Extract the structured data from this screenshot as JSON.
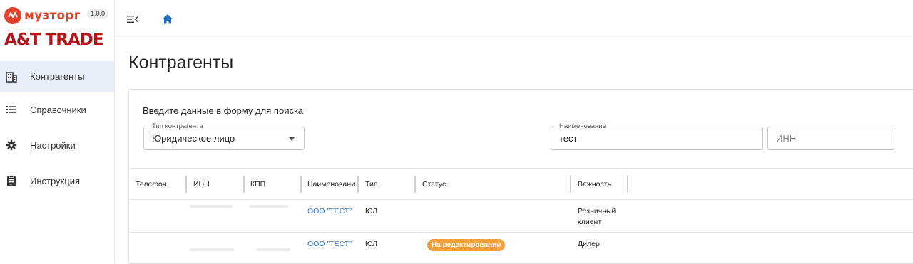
{
  "app": {
    "brand_name": "музторг",
    "brand_sub": "A&T TRADE",
    "version": "1.0.0"
  },
  "sidebar": {
    "items": [
      {
        "label": "Контрагенты",
        "icon": "building-icon",
        "active": true
      },
      {
        "label": "Справочники",
        "icon": "list-icon",
        "active": false
      },
      {
        "label": "Настройки",
        "icon": "gear-icon",
        "active": false
      },
      {
        "label": "Инструкция",
        "icon": "clipboard-icon",
        "active": false
      }
    ]
  },
  "topbar": {
    "collapse_icon": "menu-collapse-icon",
    "home_icon": "home-icon"
  },
  "page": {
    "title": "Контрагенты"
  },
  "search_form": {
    "title": "Введите данные в форму для поиска",
    "type_field": {
      "legend": "Тип контрагента",
      "value": "Юридическое лицо"
    },
    "name_field": {
      "legend": "Наименование",
      "value": "тест"
    },
    "inn_field": {
      "placeholder": "ИНН",
      "value": ""
    }
  },
  "table": {
    "columns": [
      "Телефон",
      "ИНН",
      "КПП",
      "Наименование",
      "Тип",
      "Статус",
      "Важность"
    ],
    "rows": [
      {
        "phone": "",
        "inn": "",
        "kpp": "",
        "name": "ООО \"ТЕСТ\"",
        "type": "ЮЛ",
        "status": "",
        "importance_line1": "Розничный",
        "importance_line2": "клиент"
      },
      {
        "phone": "",
        "inn": "",
        "kpp": "",
        "name": "ООО \"ТЕСТ\"",
        "type": "ЮЛ",
        "status": "На редактировании",
        "importance_line1": "Дилер",
        "importance_line2": ""
      }
    ]
  },
  "colors": {
    "brand_orange": "#e4412a",
    "brand_red": "#b8141b",
    "accent_blue": "#1f6fc5",
    "link_blue": "#2f74c0",
    "status_orange": "#f2a03a",
    "active_nav_bg": "#e8eef7"
  }
}
